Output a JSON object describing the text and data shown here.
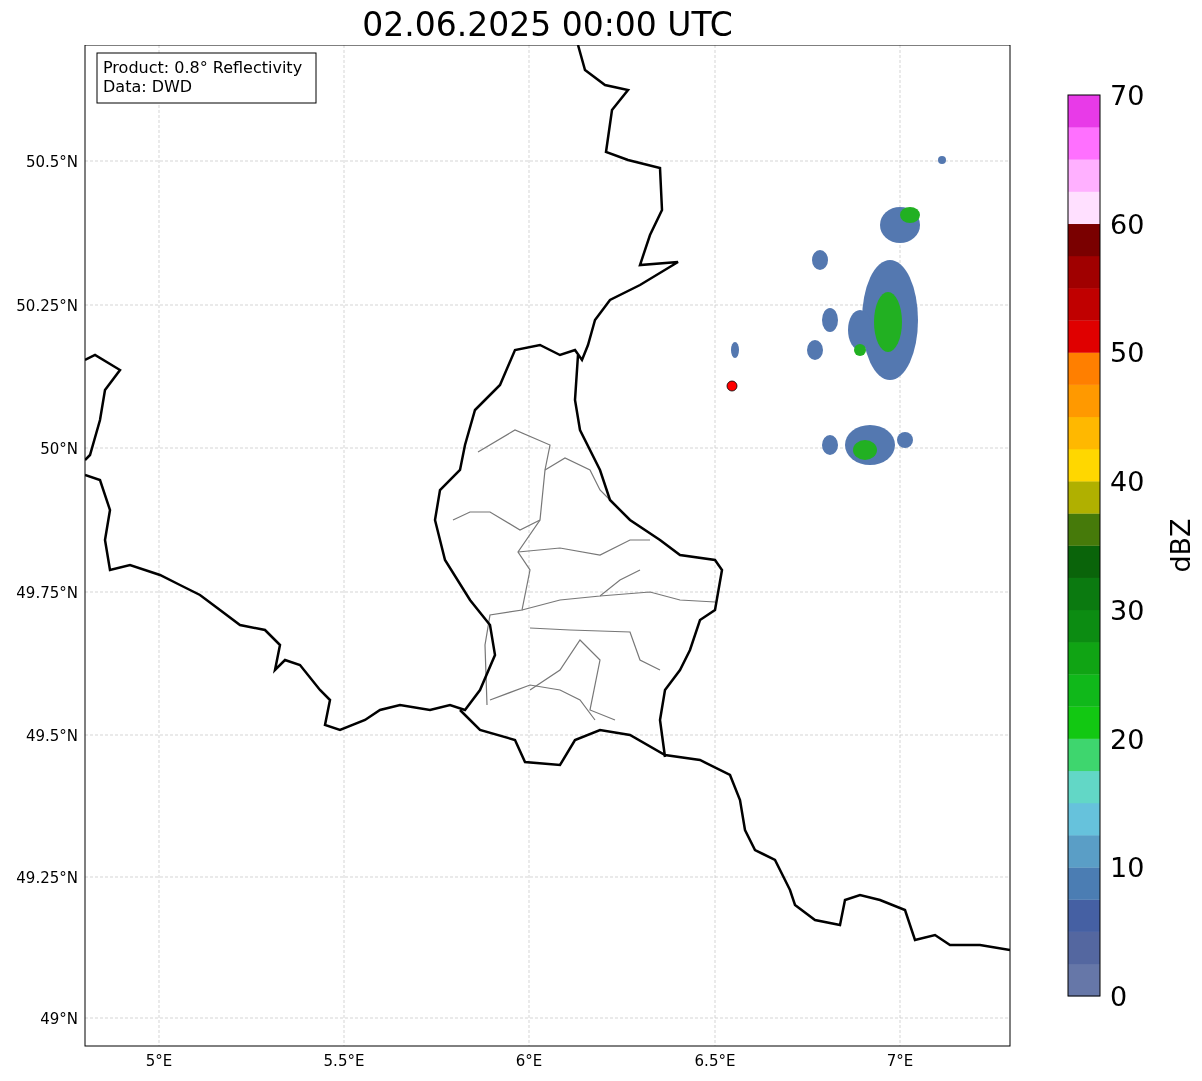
{
  "title": "02.06.2025 00:00 UTC",
  "legend": [
    "Product: 0.8° Reflectivity",
    "Data: DWD"
  ],
  "y_ticks": [
    "50.5°N",
    "50.25°N",
    "50°N",
    "49.75°N",
    "49.5°N",
    "49.25°N",
    "49°N"
  ],
  "x_ticks": [
    "5°E",
    "5.5°E",
    "6°E",
    "6.5°E",
    "7°E"
  ],
  "colorbar": {
    "label": "dBZ",
    "ticks": [
      "70",
      "60",
      "50",
      "40",
      "30",
      "20",
      "10",
      "0"
    ],
    "bands": [
      {
        "color": "#6677a8"
      },
      {
        "color": "#5467a0"
      },
      {
        "color": "#4560a3"
      },
      {
        "color": "#4b7db3"
      },
      {
        "color": "#5a9ec6"
      },
      {
        "color": "#66c2dc"
      },
      {
        "color": "#62d7c6"
      },
      {
        "color": "#3ed66e"
      },
      {
        "color": "#12c812"
      },
      {
        "color": "#10b81a"
      },
      {
        "color": "#10a414"
      },
      {
        "color": "#0c8c12"
      },
      {
        "color": "#0b7a10"
      },
      {
        "color": "#0a640a"
      },
      {
        "color": "#467a0a"
      },
      {
        "color": "#b0b000"
      },
      {
        "color": "#ffd700"
      },
      {
        "color": "#ffb800"
      },
      {
        "color": "#ff9900"
      },
      {
        "color": "#ff7f00"
      },
      {
        "color": "#e00000"
      },
      {
        "color": "#c00000"
      },
      {
        "color": "#a00000"
      },
      {
        "color": "#7a0000"
      },
      {
        "color": "#ffe0ff"
      },
      {
        "color": "#ffb0ff"
      },
      {
        "color": "#ff70ff"
      },
      {
        "color": "#e83ae8"
      }
    ]
  }
}
